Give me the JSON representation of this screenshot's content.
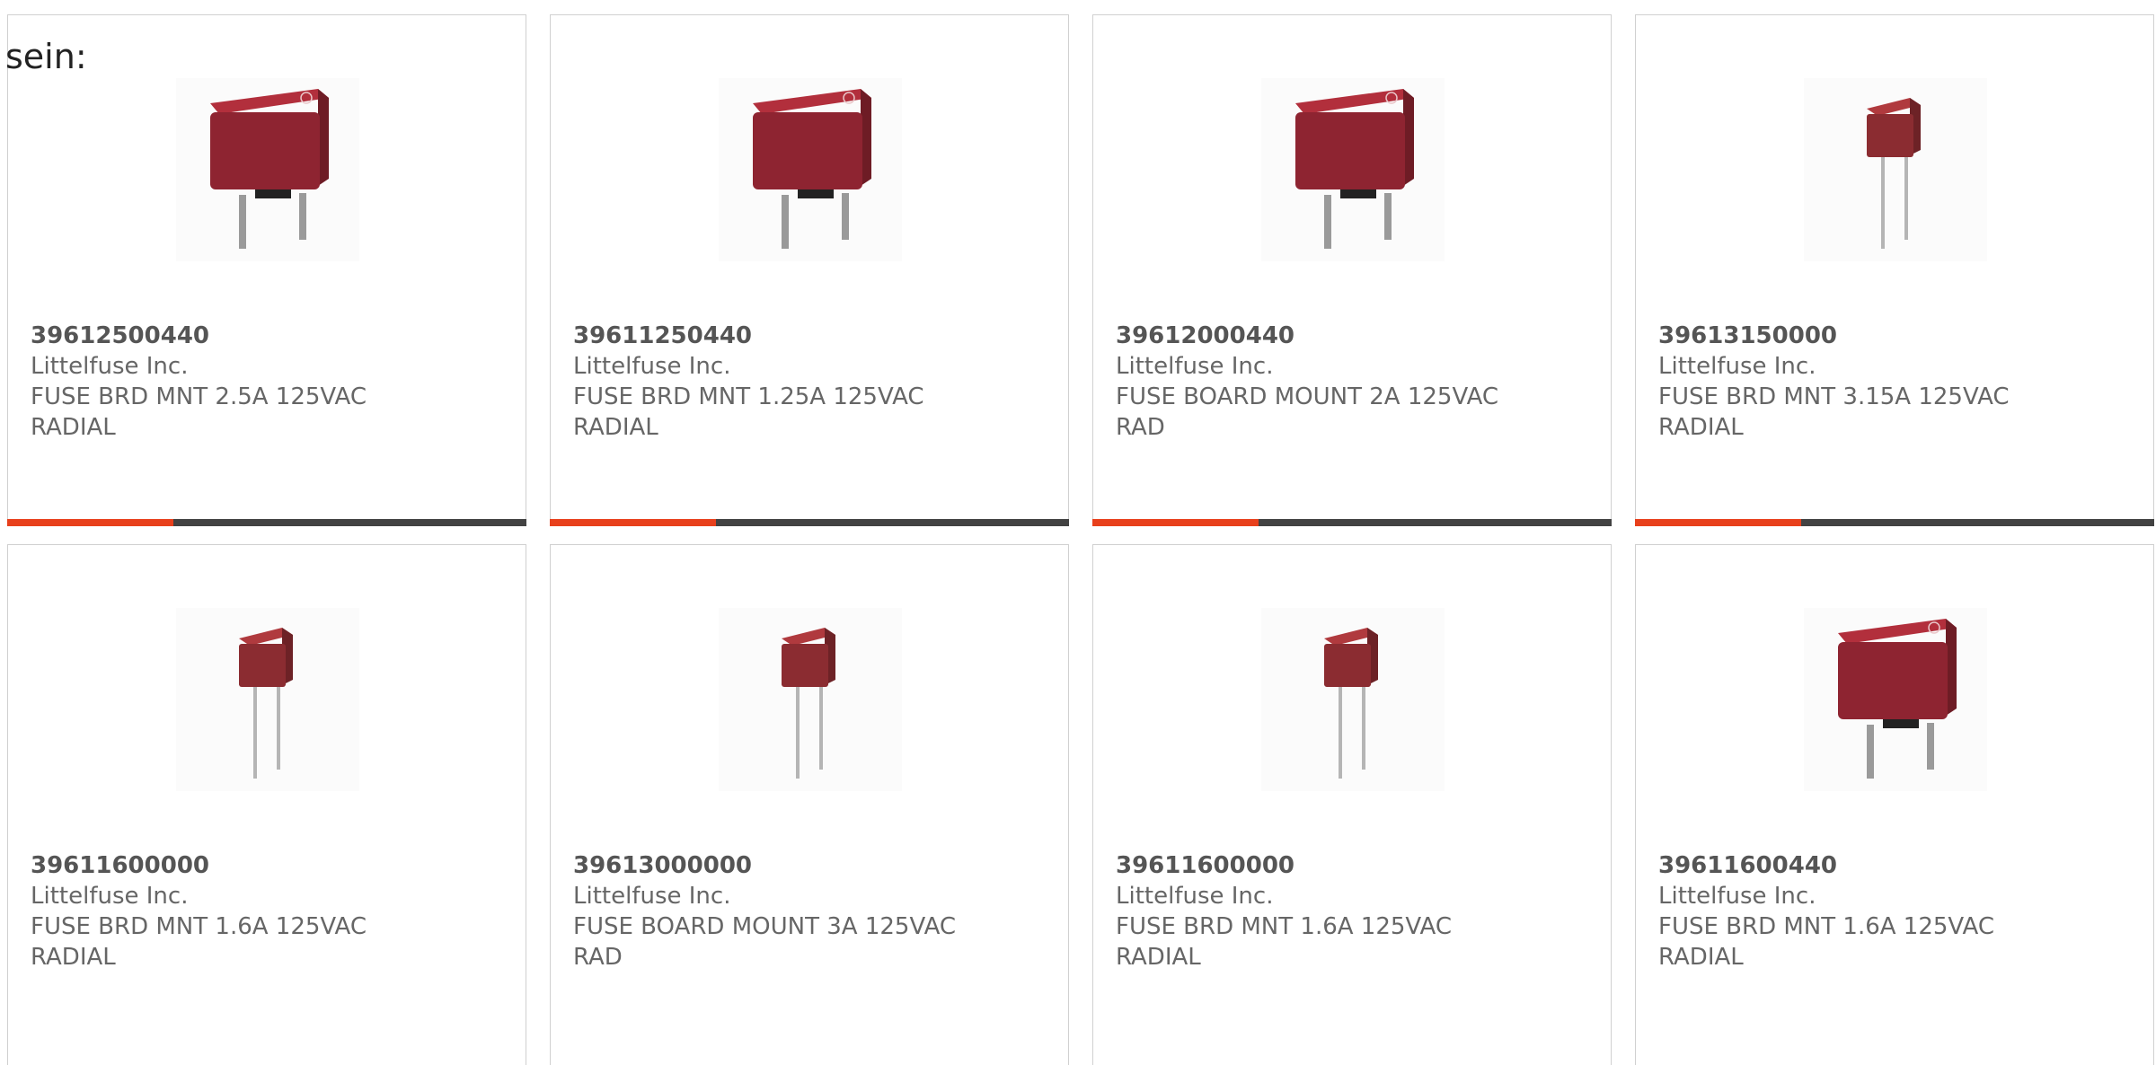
{
  "lead_text": "sein:",
  "colors": {
    "accent": "#e8401c",
    "bar_track": "#424242",
    "text": "#666666"
  },
  "products": [
    {
      "part": "39612500440",
      "mfr": "Littelfuse Inc.",
      "desc": "FUSE BRD MNT 2.5A 125VAC RADIAL",
      "img": "fuse-large",
      "progress": 0.32
    },
    {
      "part": "39611250440",
      "mfr": "Littelfuse Inc.",
      "desc": "FUSE BRD MNT 1.25A 125VAC RADIAL",
      "img": "fuse-large",
      "progress": 0.32
    },
    {
      "part": "39612000440",
      "mfr": "Littelfuse Inc.",
      "desc": "FUSE BOARD MOUNT 2A 125VAC RAD",
      "img": "fuse-large",
      "progress": 0.32
    },
    {
      "part": "39613150000",
      "mfr": "Littelfuse Inc.",
      "desc": "FUSE BRD MNT 3.15A 125VAC RADIAL",
      "img": "fuse-small",
      "progress": 0.32
    },
    {
      "part": "39611600000",
      "mfr": "Littelfuse Inc.",
      "desc": "FUSE BRD MNT 1.6A 125VAC RADIAL",
      "img": "fuse-small"
    },
    {
      "part": "39613000000",
      "mfr": "Littelfuse Inc.",
      "desc": "FUSE BOARD MOUNT 3A 125VAC RAD",
      "img": "fuse-small"
    },
    {
      "part": "39611600000",
      "mfr": "Littelfuse Inc.",
      "desc": "FUSE BRD MNT 1.6A 125VAC RADIAL",
      "img": "fuse-small"
    },
    {
      "part": "39611600440",
      "mfr": "Littelfuse Inc.",
      "desc": "FUSE BRD MNT 1.6A 125VAC RADIAL",
      "img": "fuse-large"
    }
  ]
}
